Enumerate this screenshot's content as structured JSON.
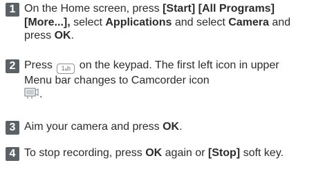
{
  "steps": [
    {
      "number": "1",
      "parts": {
        "p1": "On the Home screen, press ",
        "b1": "[Start] [All Programs] [More...],",
        "p2": " select ",
        "b2": "Applications",
        "p3": " and select ",
        "b3": "Camera",
        "p4": " and press ",
        "b4": "OK",
        "p5": "."
      }
    },
    {
      "number": "2",
      "parts": {
        "p1": "Press ",
        "key_label": "1ₐb",
        "p2": " on the keypad. The first left icon in upper Menu bar changes to Camcorder icon",
        "p3": "."
      }
    },
    {
      "number": "3",
      "parts": {
        "p1": "Aim your camera and press ",
        "b1": "OK",
        "p2": "."
      }
    },
    {
      "number": "4",
      "parts": {
        "p1": "To stop recording, press ",
        "b1": "OK",
        "p2": " again or ",
        "b2": "[Stop]",
        "p3": " soft key."
      }
    }
  ],
  "colors": {
    "badge": "#5b6266",
    "text": "#2b2b2b"
  },
  "icons": {
    "keypad_key": "keypad-1-key-icon",
    "camcorder": "camcorder-icon"
  }
}
